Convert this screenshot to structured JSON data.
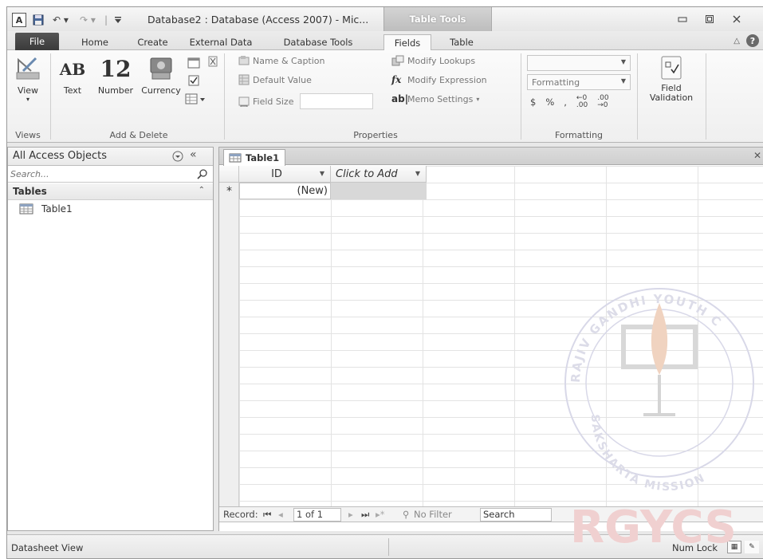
{
  "window": {
    "title": "Database2 : Database (Access 2007)  -  Mic...",
    "contextual_tab": "Table Tools",
    "controls": [
      "minimize",
      "restore",
      "close"
    ]
  },
  "ribbon_tabs": [
    {
      "label": "File"
    },
    {
      "label": "Home"
    },
    {
      "label": "Create"
    },
    {
      "label": "External Data"
    },
    {
      "label": "Database Tools"
    },
    {
      "label": "Fields"
    },
    {
      "label": "Table"
    }
  ],
  "active_tab": "Fields",
  "ribbon": {
    "views": {
      "view_label": "View",
      "group_label": "Views"
    },
    "add_delete": {
      "text_label": "Text",
      "number_label": "Number",
      "currency_label": "Currency",
      "ab_glyph": "AB",
      "num_glyph": "12",
      "group_label": "Add & Delete"
    },
    "properties": {
      "name_caption": "Name & Caption",
      "default_value": "Default Value",
      "field_size": "Field Size",
      "modify_lookups": "Modify Lookups",
      "modify_expression": "Modify Expression",
      "memo_settings": "Memo Settings",
      "group_label": "Properties"
    },
    "formatting": {
      "data_type_value": "",
      "format_value": "Formatting",
      "currency_symbol": "$",
      "percent_symbol": "%",
      "comma_symbol": ",",
      "group_label": "Formatting"
    },
    "validation": {
      "label": "Field Validation"
    }
  },
  "nav_pane": {
    "title": "All Access Objects",
    "search_placeholder": "Search...",
    "group": "Tables",
    "items": [
      {
        "label": "Table1"
      }
    ]
  },
  "document": {
    "tab_label": "Table1",
    "columns": [
      {
        "label": "ID"
      },
      {
        "label": "Click to Add"
      }
    ],
    "new_row_marker": "*",
    "new_row_value": "(New)"
  },
  "record_nav": {
    "label": "Record:",
    "position": "1 of 1",
    "filter": "No Filter",
    "search": "Search"
  },
  "status": {
    "left": "Datasheet View",
    "right": "Num Lock"
  },
  "watermark": {
    "text_top": "RAJIV GANDHI YOUTH C",
    "text_bottom": "SAKSHARTA MISSION",
    "logo_text": "RGYCS"
  },
  "colors": {
    "file_tab": "#454545",
    "contextual_tab": "#c8c8c8",
    "watermark_red": "#e8c0c0"
  }
}
